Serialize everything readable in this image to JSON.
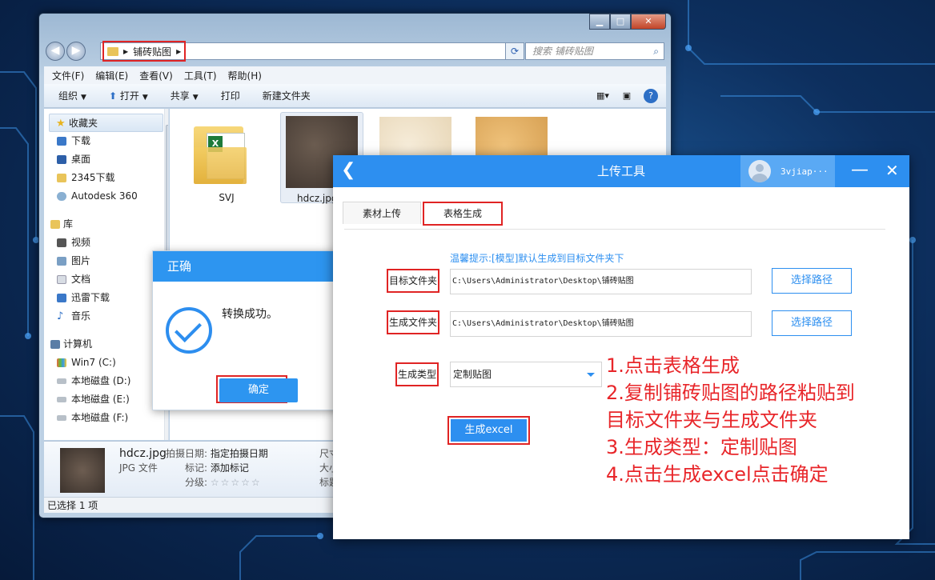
{
  "explorer": {
    "address_path": "铺砖贴图",
    "search_placeholder": "搜索 铺砖贴图",
    "menu": [
      "文件(F)",
      "编辑(E)",
      "查看(V)",
      "工具(T)",
      "帮助(H)"
    ],
    "toolbar": [
      "组织",
      "打开",
      "共享",
      "打印",
      "新建文件夹"
    ],
    "nav": {
      "favorites_label": "收藏夹",
      "favorites": [
        "下载",
        "桌面",
        "2345下载",
        "Autodesk 360"
      ],
      "libraries_label": "库",
      "libraries": [
        "视频",
        "图片",
        "文档",
        "迅雷下载",
        "音乐"
      ],
      "computer_label": "计算机",
      "drives": [
        "Win7 (C:)",
        "本地磁盘 (D:)",
        "本地磁盘 (E:)",
        "本地磁盘 (F:)"
      ]
    },
    "files": [
      {
        "name": "SVJ",
        "type": "excel-folder"
      },
      {
        "name": "hdcz.jpg",
        "type": "image",
        "color": "#4a3f37"
      },
      {
        "name": "",
        "type": "image",
        "color": "#efe2c9"
      },
      {
        "name": "",
        "type": "image",
        "color": "#e3b56a"
      }
    ],
    "details": {
      "filename": "hdcz.jpg",
      "filetype": "JPG 文件",
      "date_label": "拍摄日期:",
      "date_value": "指定拍摄日期",
      "tags_label": "标记:",
      "tags_value": "添加标记",
      "rating_label": "分级:",
      "rating_stars": "☆☆☆☆☆",
      "extra_1": "尺寸",
      "extra_2": "大小",
      "extra_3": "标题"
    },
    "status": "已选择 1 项"
  },
  "dialog": {
    "title": "正确",
    "message": "转换成功。",
    "ok_label": "确定"
  },
  "tool": {
    "title": "上传工具",
    "user": "3vjiap···",
    "tabs": [
      "素材上传",
      "表格生成"
    ],
    "hint": "温馨提示:[模型]默认生成到目标文件夹下",
    "target_label": "目标文件夹",
    "target_path": "C:\\Users\\Administrator\\Desktop\\铺砖贴图",
    "output_label": "生成文件夹",
    "output_path": "C:\\Users\\Administrator\\Desktop\\铺砖贴图",
    "choose_path": "选择路径",
    "type_label": "生成类型",
    "type_value": "定制贴图",
    "generate_label": "生成excel",
    "colors": {
      "accent": "#2d8ff0",
      "highlight": "#e02424"
    }
  },
  "instructions": [
    "1.点击表格生成",
    "2.复制铺砖贴图的路径粘贴到",
    "目标文件夹与生成文件夹",
    "3.生成类型：定制贴图",
    "4.点击生成excel点击确定"
  ]
}
